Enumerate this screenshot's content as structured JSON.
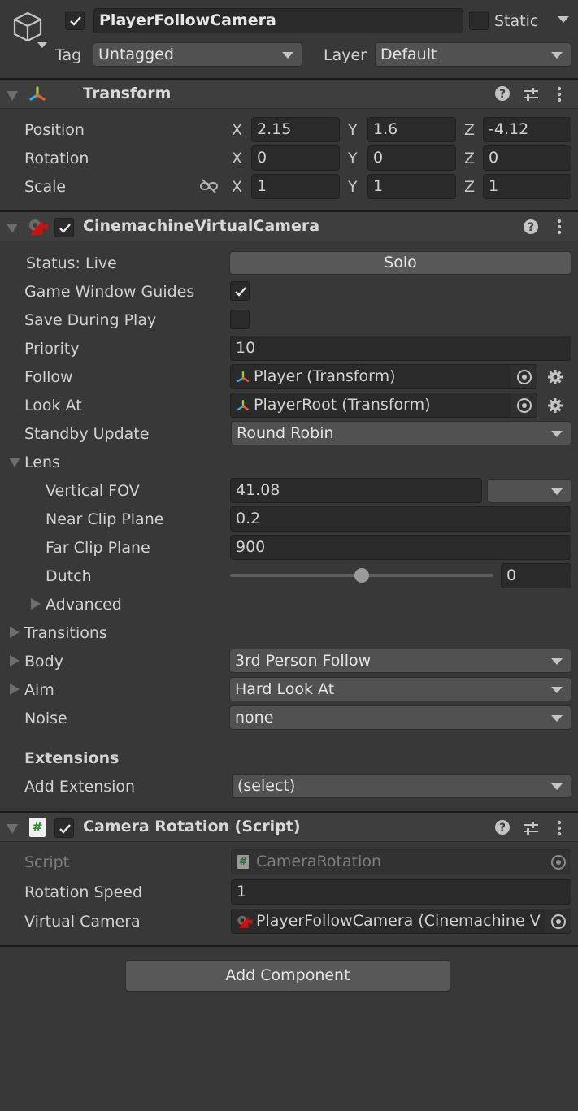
{
  "object": {
    "name": "PlayerFollowCamera",
    "active": true,
    "static_label": "Static",
    "static": false,
    "tag_label": "Tag",
    "tag": "Untagged",
    "layer_label": "Layer",
    "layer": "Default"
  },
  "transform": {
    "title": "Transform",
    "rows": [
      {
        "label": "Position",
        "x": "2.15",
        "y": "1.6",
        "z": "-4.12"
      },
      {
        "label": "Rotation",
        "x": "0",
        "y": "0",
        "z": "0"
      },
      {
        "label": "Scale",
        "x": "1",
        "y": "1",
        "z": "1"
      }
    ],
    "axis_labels": {
      "x": "X",
      "y": "Y",
      "z": "Z"
    }
  },
  "vcam": {
    "title": "CinemachineVirtualCamera",
    "enabled": true,
    "status_label": "Status: Live",
    "solo_label": "Solo",
    "game_window_guides_label": "Game Window Guides",
    "game_window_guides": true,
    "save_during_play_label": "Save During Play",
    "save_during_play": false,
    "priority_label": "Priority",
    "priority": "10",
    "follow_label": "Follow",
    "follow": "Player (Transform)",
    "look_at_label": "Look At",
    "look_at": "PlayerRoot (Transform)",
    "standby_label": "Standby Update",
    "standby": "Round Robin",
    "lens": {
      "label": "Lens",
      "vfov_label": "Vertical FOV",
      "vfov": "41.08",
      "near_label": "Near Clip Plane",
      "near": "0.2",
      "far_label": "Far Clip Plane",
      "far": "900",
      "dutch_label": "Dutch",
      "dutch": "0",
      "dutch_slider_fraction": 0.5,
      "advanced_label": "Advanced"
    },
    "transitions_label": "Transitions",
    "body_label": "Body",
    "body": "3rd Person Follow",
    "aim_label": "Aim",
    "aim": "Hard Look At",
    "noise_label": "Noise",
    "noise": "none",
    "extensions_label": "Extensions",
    "add_extension_label": "Add Extension",
    "add_extension": "(select)"
  },
  "camrot": {
    "title": "Camera Rotation (Script)",
    "enabled": true,
    "script_label": "Script",
    "script": "CameraRotation",
    "speed_label": "Rotation Speed",
    "speed": "1",
    "vcam_label": "Virtual Camera",
    "vcam": "PlayerFollowCamera (Cinemachine V"
  },
  "add_component_label": "Add Component"
}
